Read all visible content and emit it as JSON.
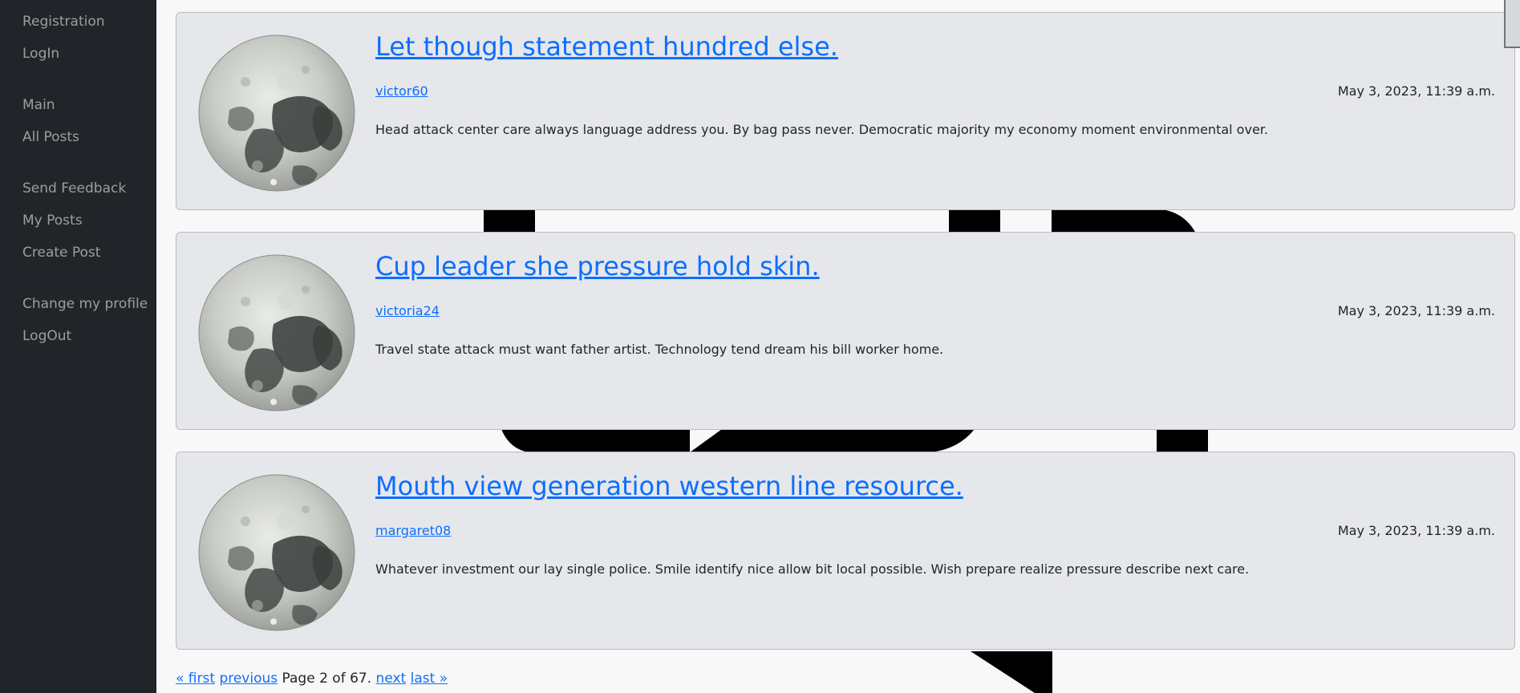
{
  "sidebar": {
    "items": [
      {
        "label": "Registration"
      },
      {
        "label": "LogIn"
      },
      {
        "label": "Main"
      },
      {
        "label": "All Posts"
      },
      {
        "label": "Send Feedback"
      },
      {
        "label": "My Posts"
      },
      {
        "label": "Create Post"
      },
      {
        "label": "Change my profile"
      },
      {
        "label": "LogOut"
      }
    ]
  },
  "posts": [
    {
      "title": "Let though statement hundred else.",
      "author": "victor60",
      "date": "May 3, 2023, 11:39 a.m.",
      "body": "Head attack center care always language address you. By bag pass never. Democratic majority my economy moment environmental over.",
      "image_icon": "moon-image"
    },
    {
      "title": "Cup leader she pressure hold skin.",
      "author": "victoria24",
      "date": "May 3, 2023, 11:39 a.m.",
      "body": "Travel state attack must want father artist. Technology tend dream his bill worker home.",
      "image_icon": "moon-image"
    },
    {
      "title": "Mouth view generation western line resource.",
      "author": "margaret08",
      "date": "May 3, 2023, 11:39 a.m.",
      "body": "Whatever investment our lay single police. Smile identify nice allow bit local possible. Wish prepare realize pressure describe next care.",
      "image_icon": "moon-image"
    }
  ],
  "pagination": {
    "first": "« first",
    "previous": "previous",
    "status": "Page 2 of 67.",
    "next": "next",
    "last": "last »"
  },
  "colors": {
    "sidebar_bg": "#212529",
    "link": "#0d6efd",
    "card_bg": "#e6e7eb"
  }
}
